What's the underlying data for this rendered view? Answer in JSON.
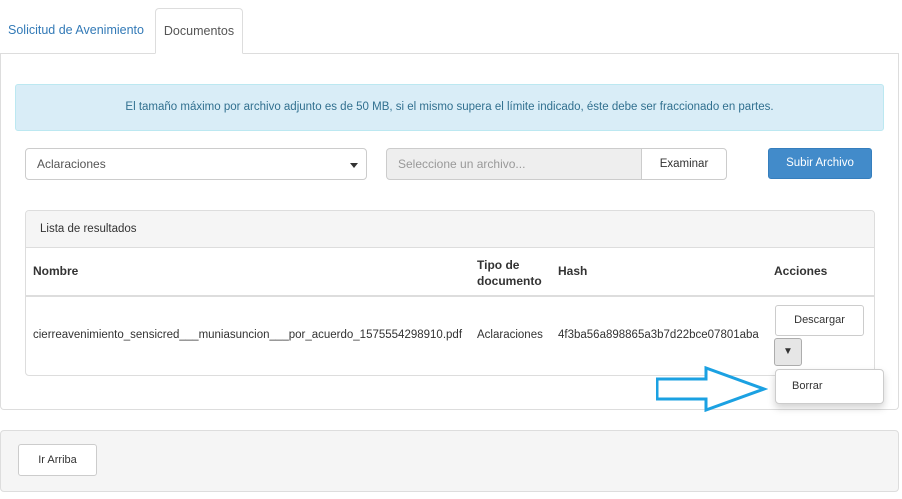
{
  "tabs": [
    {
      "label": "Solicitud de Avenimiento",
      "active": false
    },
    {
      "label": "Documentos",
      "active": true
    }
  ],
  "alert": {
    "text": "El tamaño máximo por archivo adjunto es de 50 MB, si el mismo supera el límite indicado, éste debe ser fraccionado en partes."
  },
  "upload": {
    "document_type": "Aclaraciones",
    "file_placeholder": "Seleccione un archivo...",
    "browse_label": "Examinar",
    "submit_label": "Subir Archivo"
  },
  "results": {
    "heading": "Lista de resultados",
    "columns": [
      "Nombre",
      "Tipo de documento",
      "Hash",
      "Acciones"
    ],
    "rows": [
      {
        "name": "cierreavenimiento_sensicred___muniasuncion___por_acuerdo_1575554298910.pdf",
        "type": "Aclaraciones",
        "hash": "4f3ba56a898865a3b7d22bce07801aba",
        "download_label": "Descargar",
        "toggle_label": "▼"
      }
    ]
  },
  "dropdown_menu": {
    "items": [
      "Borrar"
    ]
  },
  "footer": {
    "top_button_label": "Ir Arriba"
  },
  "colors": {
    "link": "#337ab7",
    "primary": "#428bca",
    "alert_bg": "#d9edf7",
    "alert_text": "#31708f",
    "arrow": "#1ba1e2"
  }
}
